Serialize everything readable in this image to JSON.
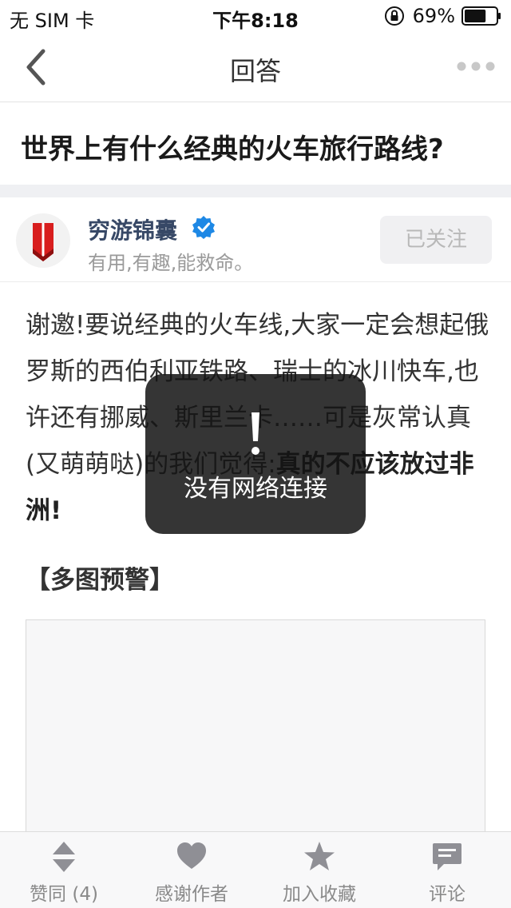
{
  "status_bar": {
    "carrier": "无 SIM 卡",
    "time": "下午8:18",
    "battery_percent": "69%",
    "battery_level": 0.69
  },
  "nav": {
    "title": "回答"
  },
  "question": {
    "title": "世界上有什么经典的火车旅行路线?"
  },
  "author": {
    "name": "穷游锦囊",
    "bio": "有用,有趣,能救命。",
    "follow_label": "已关注"
  },
  "answer": {
    "paragraph": "谢邀!要说经典的火车线,大家一定会想起俄罗斯的西伯利亚铁路、瑞士的冰川快车,也许还有挪威、斯里兰卡……可是灰常认真(又萌萌哒)的我们觉得:",
    "bold_text": "真的不应该放过非洲!",
    "section_heading": "【多图预警】"
  },
  "toast": {
    "message": "没有网络连接"
  },
  "tab_bar": {
    "items": [
      {
        "label": "赞同 (4)",
        "icon": "vote-arrows-icon"
      },
      {
        "label": "感谢作者",
        "icon": "heart-icon"
      },
      {
        "label": "加入收藏",
        "icon": "star-icon"
      },
      {
        "label": "评论",
        "icon": "comment-icon"
      }
    ]
  },
  "colors": {
    "accent_verified": "#1e88e5",
    "author_name": "#374866",
    "logo_red": "#d81e1e"
  }
}
